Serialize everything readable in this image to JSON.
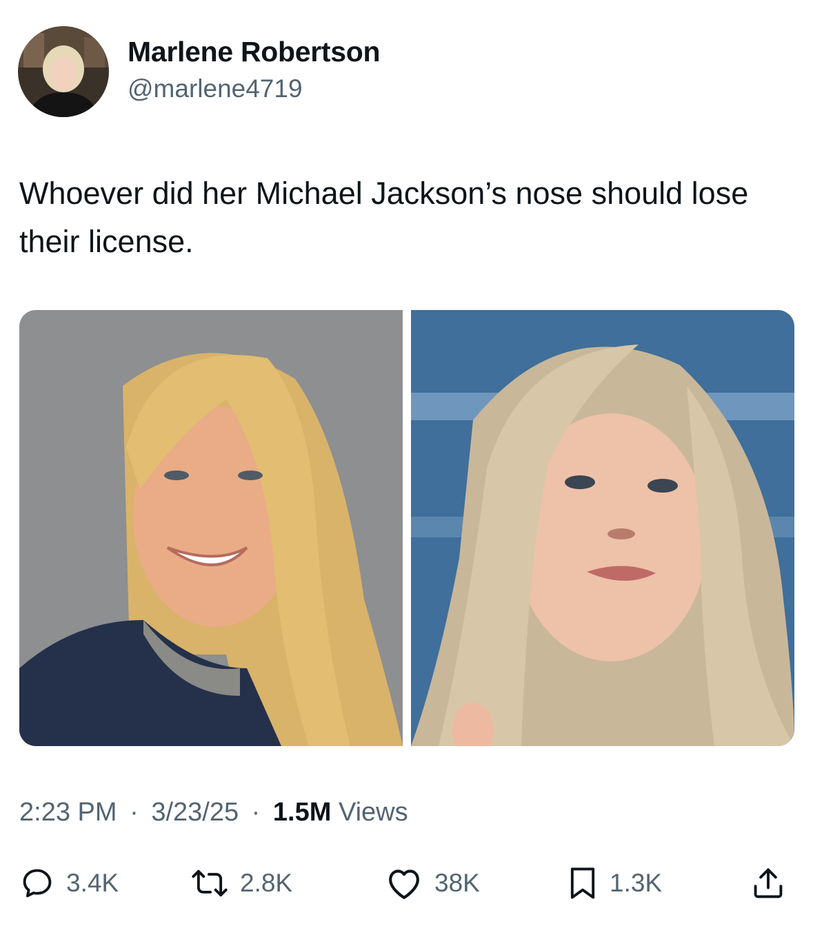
{
  "author": {
    "display_name": "Marlene Robertson",
    "handle": "@marlene4719",
    "avatar_icon": "profile-photo"
  },
  "tweet": {
    "text": "Whoever did her Michael Jackson’s nose should lose their license."
  },
  "media": [
    {
      "icon": "photo-left",
      "background": "#8d8f91"
    },
    {
      "icon": "photo-right",
      "background": "#3f6f9a"
    }
  ],
  "meta": {
    "time": "2:23 PM",
    "date": "3/23/25",
    "separator": "·",
    "views_count": "1.5M",
    "views_label": "Views"
  },
  "actions": {
    "reply": {
      "icon": "reply-icon",
      "count": "3.4K"
    },
    "retweet": {
      "icon": "retweet-icon",
      "count": "2.8K"
    },
    "like": {
      "icon": "heart-icon",
      "count": "38K"
    },
    "bookmark": {
      "icon": "bookmark-icon",
      "count": "1.3K"
    },
    "share": {
      "icon": "share-icon"
    }
  },
  "colors": {
    "text_primary": "#0f1419",
    "text_secondary": "#536471",
    "background": "#ffffff"
  }
}
